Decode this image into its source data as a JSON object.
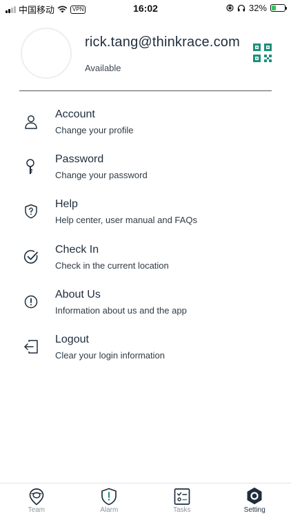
{
  "status_bar": {
    "carrier": "中国移动",
    "vpn": "VPN",
    "time": "16:02",
    "battery": "32%",
    "battery_level": 0.32
  },
  "profile": {
    "email": "rick.tang@thinkrace.com",
    "status": "Available"
  },
  "menu": {
    "items": [
      {
        "title": "Account",
        "subtitle": "Change your profile",
        "icon": "person-icon"
      },
      {
        "title": "Password",
        "subtitle": "Change your password",
        "icon": "key-icon"
      },
      {
        "title": "Help",
        "subtitle": "Help center, user manual and FAQs",
        "icon": "help-shield-icon"
      },
      {
        "title": "Check In",
        "subtitle": "Check in the current location",
        "icon": "check-circle-icon"
      },
      {
        "title": "About Us",
        "subtitle": "Information about us and the app",
        "icon": "info-circle-icon"
      },
      {
        "title": "Logout",
        "subtitle": "Clear your login information",
        "icon": "logout-icon"
      }
    ]
  },
  "tabbar": {
    "tabs": [
      {
        "label": "Team",
        "icon": "location-pin-icon"
      },
      {
        "label": "Alarm",
        "icon": "alarm-shield-icon"
      },
      {
        "label": "Tasks",
        "icon": "task-list-icon"
      },
      {
        "label": "Setting",
        "icon": "settings-gear-icon",
        "active": true
      }
    ]
  },
  "colors": {
    "accent": "#1e8f7a",
    "text": "#1f2d3d",
    "tab_inactive": "#8f959b",
    "battery": "#34c759"
  }
}
